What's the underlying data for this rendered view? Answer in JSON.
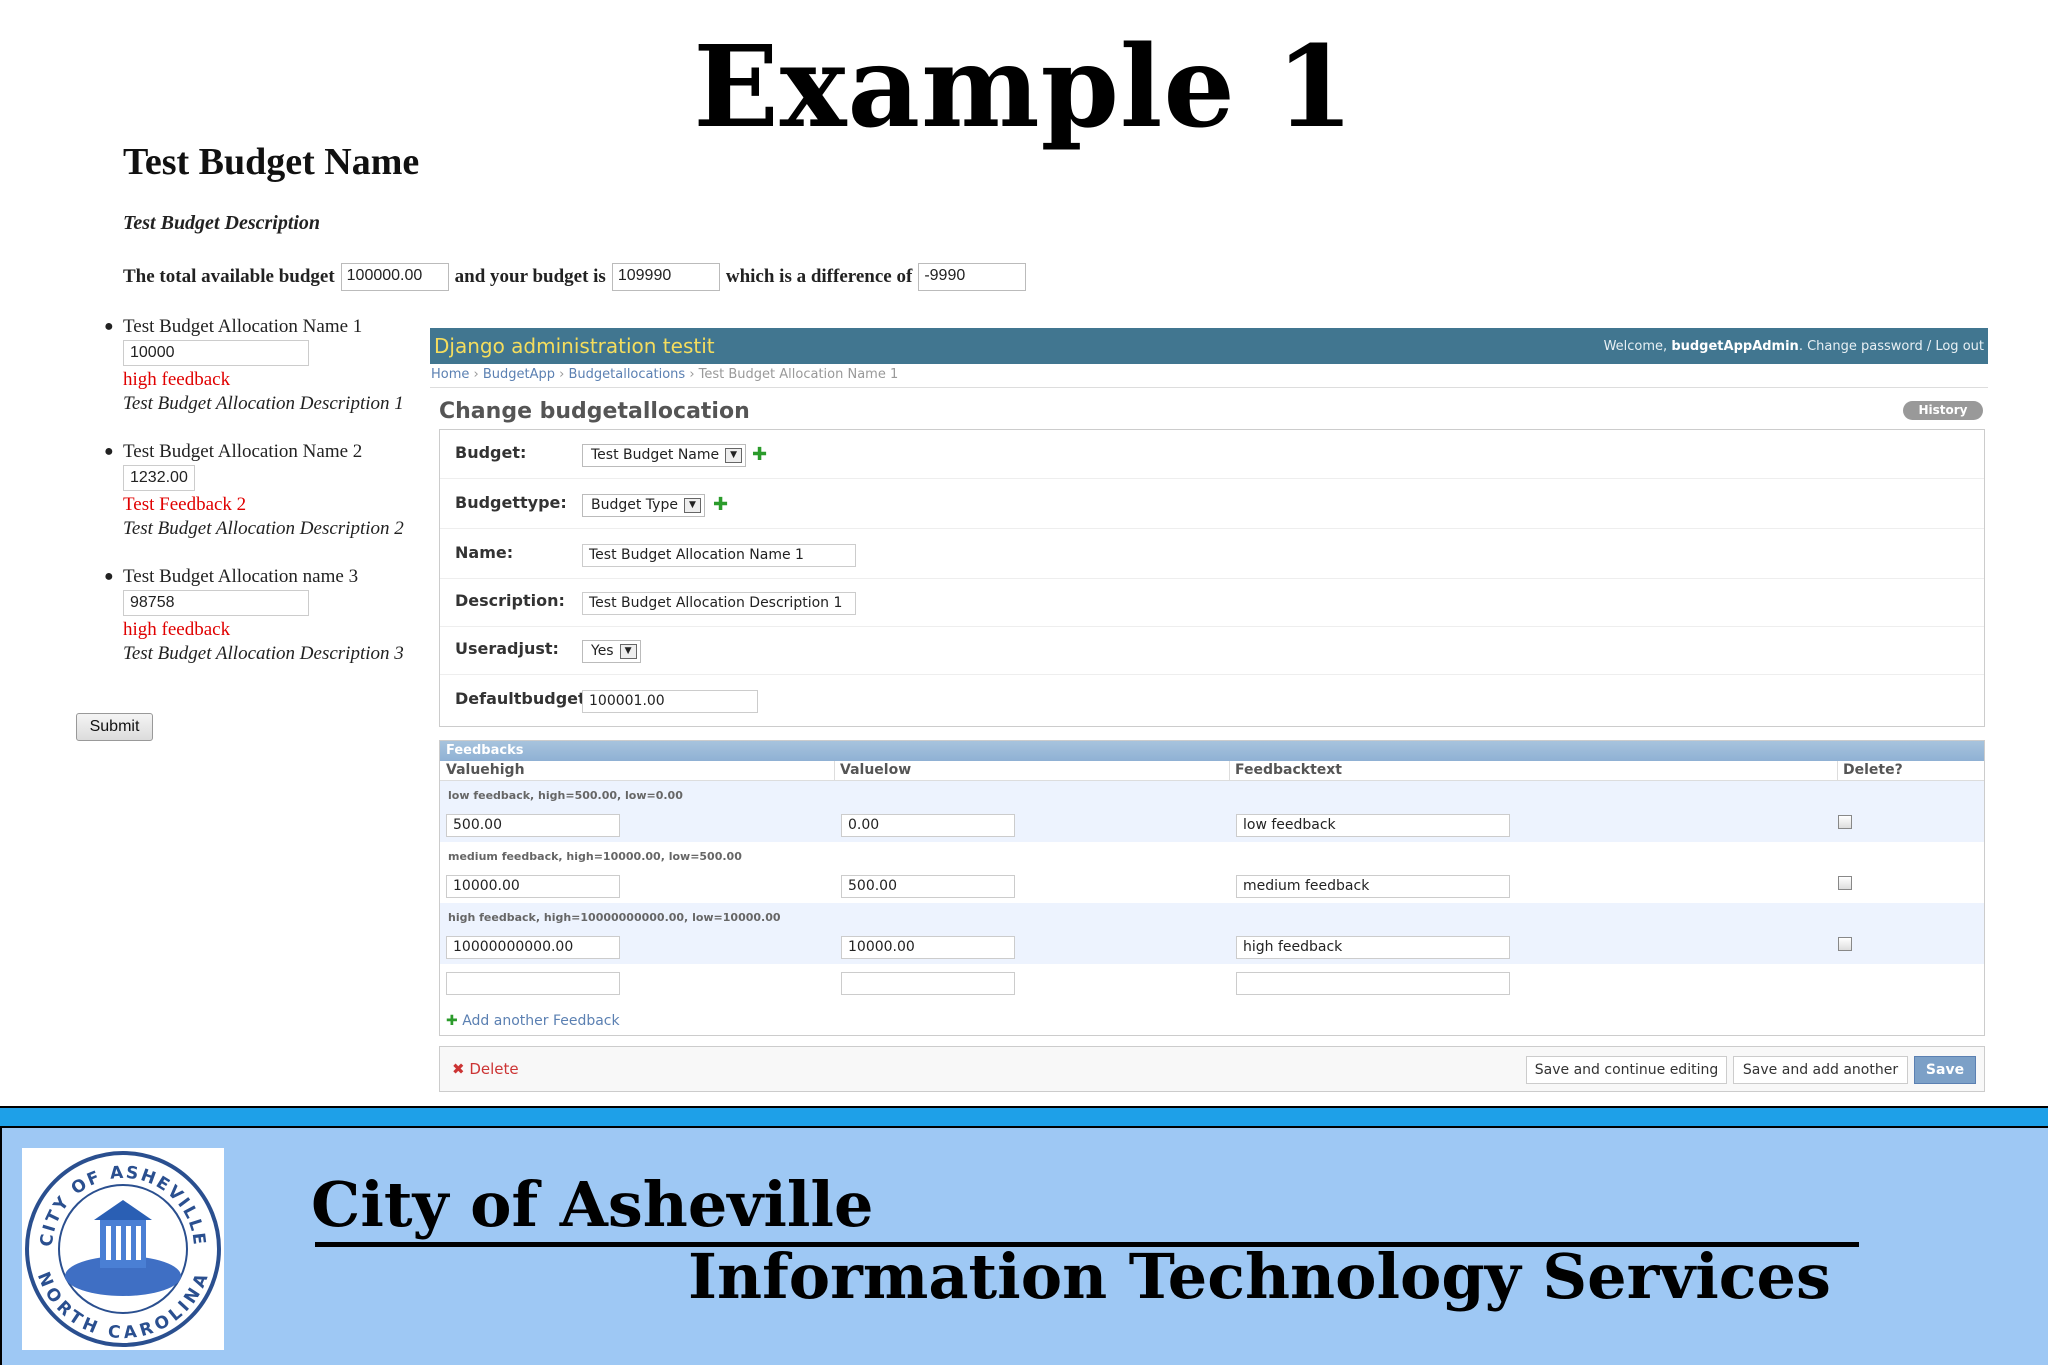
{
  "slide": {
    "title": "Example 1"
  },
  "form": {
    "budget_name": "Test Budget Name",
    "budget_description": "Test Budget Description",
    "total_label": "The total available budget",
    "total_value": "100000.00",
    "your_budget_label": "and your budget is",
    "your_budget_value": "109990",
    "difference_label": "which is a difference of",
    "difference_value": "-9990",
    "allocations": [
      {
        "name": "Test Budget Allocation Name 1",
        "value": "10000",
        "feedback": "high feedback",
        "description": "Test Budget Allocation Description 1"
      },
      {
        "name": "Test Budget Allocation Name 2",
        "value": "1232.00",
        "feedback": "Test Feedback 2",
        "description": "Test Budget Allocation Description 2"
      },
      {
        "name": "Test Budget Allocation name 3",
        "value": "98758",
        "feedback": "high feedback",
        "description": "Test Budget Allocation Description 3"
      }
    ],
    "submit_label": "Submit"
  },
  "admin": {
    "branding": "Django administration testit",
    "welcome": "Welcome,",
    "username": "budgetAppAdmin",
    "user_links": ". Change password / Log out",
    "breadcrumbs": [
      "Home",
      "BudgetApp",
      "Budgetallocations",
      "Test Budget Allocation Name 1"
    ],
    "page_title": "Change budgetallocation",
    "history_label": "History",
    "fields": {
      "budget": {
        "label": "Budget:",
        "value": "Test Budget Name"
      },
      "budgettype": {
        "label": "Budgettype:",
        "value": "Budget Type"
      },
      "name": {
        "label": "Name:",
        "value": "Test Budget Allocation Name 1"
      },
      "description": {
        "label": "Description:",
        "value": "Test Budget Allocation Description 1"
      },
      "useradjust": {
        "label": "Useradjust:",
        "value": "Yes"
      },
      "defaultbudget": {
        "label": "Defaultbudget:",
        "value": "100001.00"
      }
    },
    "inline": {
      "title": "Feedbacks",
      "columns": [
        "Valuehigh",
        "Valuelow",
        "Feedbacktext",
        "Delete?"
      ],
      "rows": [
        {
          "original": "low feedback, high=500.00, low=0.00",
          "valuehigh": "500.00",
          "valuelow": "0.00",
          "text": "low feedback"
        },
        {
          "original": "medium feedback, high=10000.00, low=500.00",
          "valuehigh": "10000.00",
          "valuelow": "500.00",
          "text": "medium feedback"
        },
        {
          "original": "high feedback, high=10000000000.00, low=10000.00",
          "valuehigh": "10000000000.00",
          "valuelow": "10000.00",
          "text": "high feedback"
        }
      ],
      "add_another": "Add another Feedback"
    },
    "submit_row": {
      "delete": "Delete",
      "save_continue": "Save and continue editing",
      "save_add": "Save and add another",
      "save": "Save"
    }
  },
  "footer": {
    "city": "City of Asheville",
    "department": "Information Technology Services",
    "seal_text_top": "CITY OF ASHEVILLE",
    "seal_text_bottom": "NORTH CAROLINA"
  },
  "colors": {
    "admin_header": "#417690",
    "branding_text": "#f5dd5d",
    "feedback_red": "#e00000",
    "footer_bg": "#9ec8f4",
    "footer_stripe": "#1ea0e8"
  }
}
